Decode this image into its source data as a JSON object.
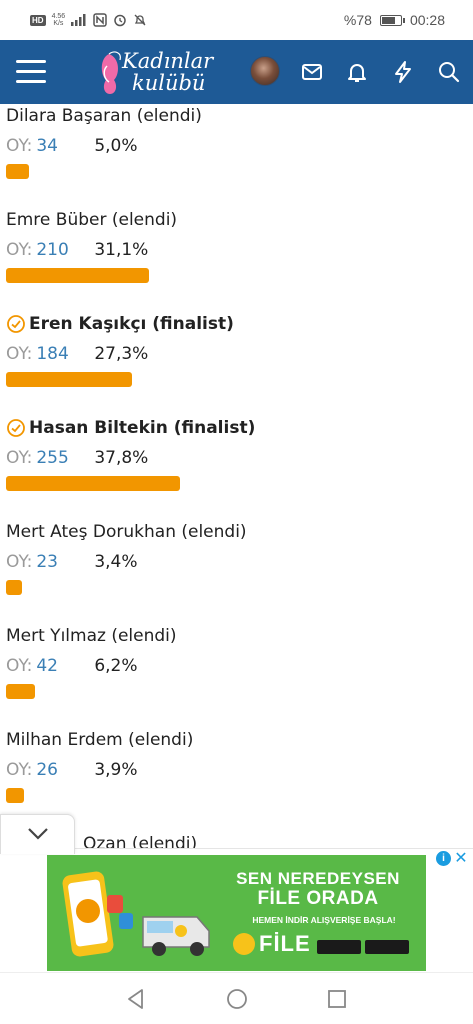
{
  "status_bar": {
    "hd": "HD",
    "net_speed_value": "4.56",
    "net_speed_unit": "K/s",
    "battery_percent": "%78",
    "battery_level": 0.78,
    "time": "00:28"
  },
  "header": {
    "logo_line1": "Kadınlar",
    "logo_line2": "kulübü",
    "colors": {
      "header_bg": "#1e5a96"
    }
  },
  "poll": {
    "vote_label": "OY:",
    "bar_color": "#f29600",
    "entries": [
      {
        "name": "Dilara Başaran (elendi)",
        "votes": "34",
        "percent": "5,0%",
        "share": 0.05,
        "finalist": false
      },
      {
        "name": "Emre Büber (elendi)",
        "votes": "210",
        "percent": "31,1%",
        "share": 0.311,
        "finalist": false
      },
      {
        "name": "Eren Kaşıkçı (finalist)",
        "votes": "184",
        "percent": "27,3%",
        "share": 0.273,
        "finalist": true
      },
      {
        "name": "Hasan Biltekin (finalist)",
        "votes": "255",
        "percent": "37,8%",
        "share": 0.378,
        "finalist": true
      },
      {
        "name": "Mert Ateş Dorukhan (elendi)",
        "votes": "23",
        "percent": "3,4%",
        "share": 0.034,
        "finalist": false
      },
      {
        "name": "Mert Yılmaz (elendi)",
        "votes": "42",
        "percent": "6,2%",
        "share": 0.062,
        "finalist": false
      },
      {
        "name": "Milhan Erdem (elendi)",
        "votes": "26",
        "percent": "3,9%",
        "share": 0.039,
        "finalist": false
      },
      {
        "name": "Ozan (elendi)",
        "votes": "",
        "percent": "",
        "share": null,
        "finalist": false
      }
    ]
  },
  "ad": {
    "headline_line1": "SEN NEREDEYSEN",
    "headline_line2": "FİLE ORADA",
    "subline": "HEMEN İNDİR ALIŞVERİŞE BAŞLA!",
    "brand": "FİLE",
    "info_label": "i",
    "close_label": "✕",
    "colors": {
      "bg": "#59b947"
    }
  },
  "icons": [
    "menu-icon",
    "mail-icon",
    "bell-icon",
    "lightning-icon",
    "search-icon",
    "check-circle-icon",
    "chevron-down-icon",
    "back-icon",
    "home-icon",
    "recents-icon"
  ]
}
